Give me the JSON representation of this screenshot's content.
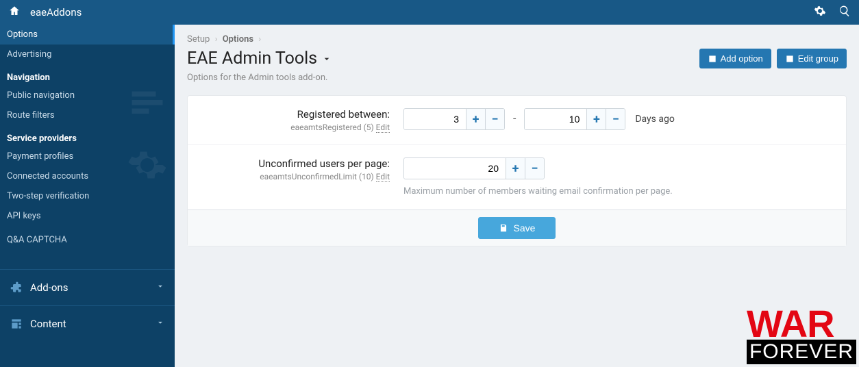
{
  "topbar": {
    "brand": "eaeAddons"
  },
  "sidebar": {
    "items_top": [
      "Options",
      "Advertising"
    ],
    "nav_heading": "Navigation",
    "nav_items": [
      "Public navigation",
      "Route filters"
    ],
    "sp_heading": "Service providers",
    "sp_items": [
      "Payment profiles",
      "Connected accounts",
      "Two-step verification",
      "API keys",
      "Q&A CAPTCHA"
    ],
    "sections": [
      {
        "label": "Add-ons",
        "icon": "puzzle"
      },
      {
        "label": "Content",
        "icon": "news"
      }
    ]
  },
  "breadcrumb": {
    "root": "Setup",
    "current": "Options"
  },
  "page": {
    "title": "EAE Admin Tools",
    "subtitle": "Options for the Admin tools add-on.",
    "add_option": "Add option",
    "edit_group": "Edit group"
  },
  "form": {
    "row1": {
      "label": "Registered between:",
      "meta": "eaeamtsRegistered (5)",
      "edit": "Edit",
      "val1": "3",
      "val2": "10",
      "suffix": "Days ago"
    },
    "row2": {
      "label": "Unconfirmed users per page:",
      "meta": "eaeamtsUnconfirmedLimit (10)",
      "edit": "Edit",
      "val": "20",
      "hint": "Maximum number of members waiting email confirmation per page."
    },
    "save": "Save"
  },
  "watermark": {
    "line1": "WAR",
    "line2": "FOREVER"
  }
}
